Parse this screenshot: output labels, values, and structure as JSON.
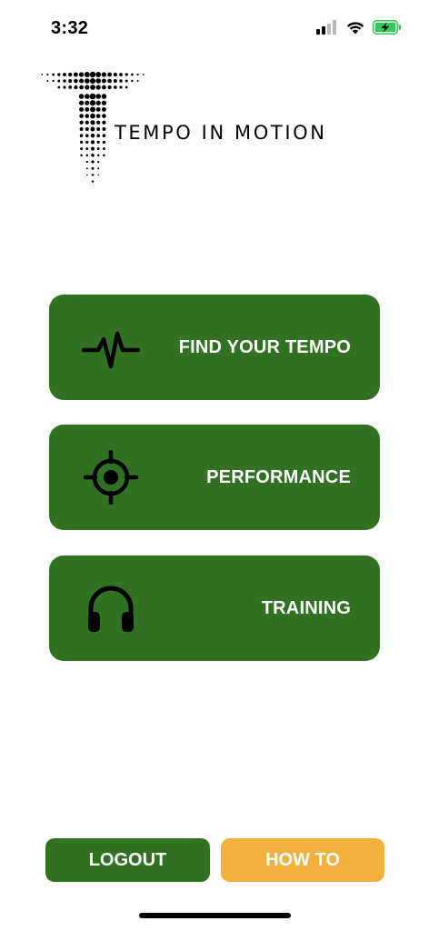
{
  "status_bar": {
    "time": "3:32",
    "icons": [
      "cellular-signal-icon",
      "wifi-icon",
      "battery-charging-icon"
    ],
    "battery_color": "#35c759"
  },
  "logo": {
    "text": "TEMPO IN MOTION"
  },
  "menu": {
    "items": [
      {
        "label": "FIND YOUR TEMPO",
        "icon": "heartbeat-icon"
      },
      {
        "label": "PERFORMANCE",
        "icon": "crosshair-target-icon"
      },
      {
        "label": "TRAINING",
        "icon": "headphones-icon"
      }
    ]
  },
  "footer": {
    "logout_label": "LOGOUT",
    "howto_label": "HOW TO"
  },
  "colors": {
    "primary_green": "#317222",
    "accent_yellow": "#f2b13c",
    "text_white": "#ffffff"
  }
}
